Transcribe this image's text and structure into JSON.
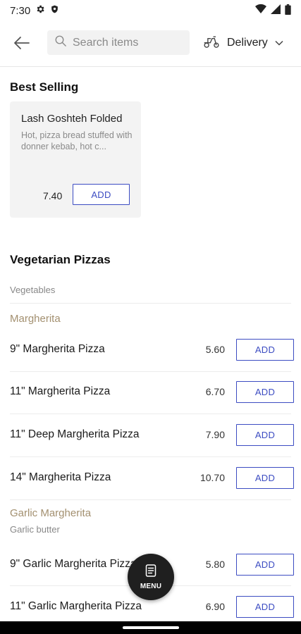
{
  "status_bar": {
    "time": "7:30"
  },
  "top_bar": {
    "search_placeholder": "Search items",
    "delivery_label": "Delivery"
  },
  "best_selling": {
    "title": "Best Selling",
    "item": {
      "name": "Lash Goshteh Folded",
      "description": "Hot, pizza bread stuffed with donner kebab, hot c...",
      "price": "7.40",
      "add_label": "ADD"
    }
  },
  "vegetarian": {
    "title": "Vegetarian Pizzas",
    "subtitle": "Vegetables",
    "groups": [
      {
        "label": "Margherita",
        "description": "",
        "items": [
          {
            "name": "9\" Margherita Pizza",
            "price": "5.60",
            "add_label": "ADD"
          },
          {
            "name": "11\" Margherita Pizza",
            "price": "6.70",
            "add_label": "ADD"
          },
          {
            "name": "11\" Deep Margherita Pizza",
            "price": "7.90",
            "add_label": "ADD"
          },
          {
            "name": "14\"  Margherita Pizza",
            "price": "10.70",
            "add_label": "ADD"
          }
        ]
      },
      {
        "label": "Garlic Margherita",
        "description": "Garlic butter",
        "items": [
          {
            "name": "9\" Garlic Margherita Pizza",
            "price": "5.80",
            "add_label": "ADD"
          },
          {
            "name": "11\" Garlic Margherita Pizza",
            "price": "6.90",
            "add_label": "ADD"
          }
        ]
      }
    ]
  },
  "fab": {
    "label": "MENU",
    "icon": "menu-doc-icon"
  },
  "colors": {
    "accent": "#3c4cc2",
    "group_label": "#a39070"
  }
}
